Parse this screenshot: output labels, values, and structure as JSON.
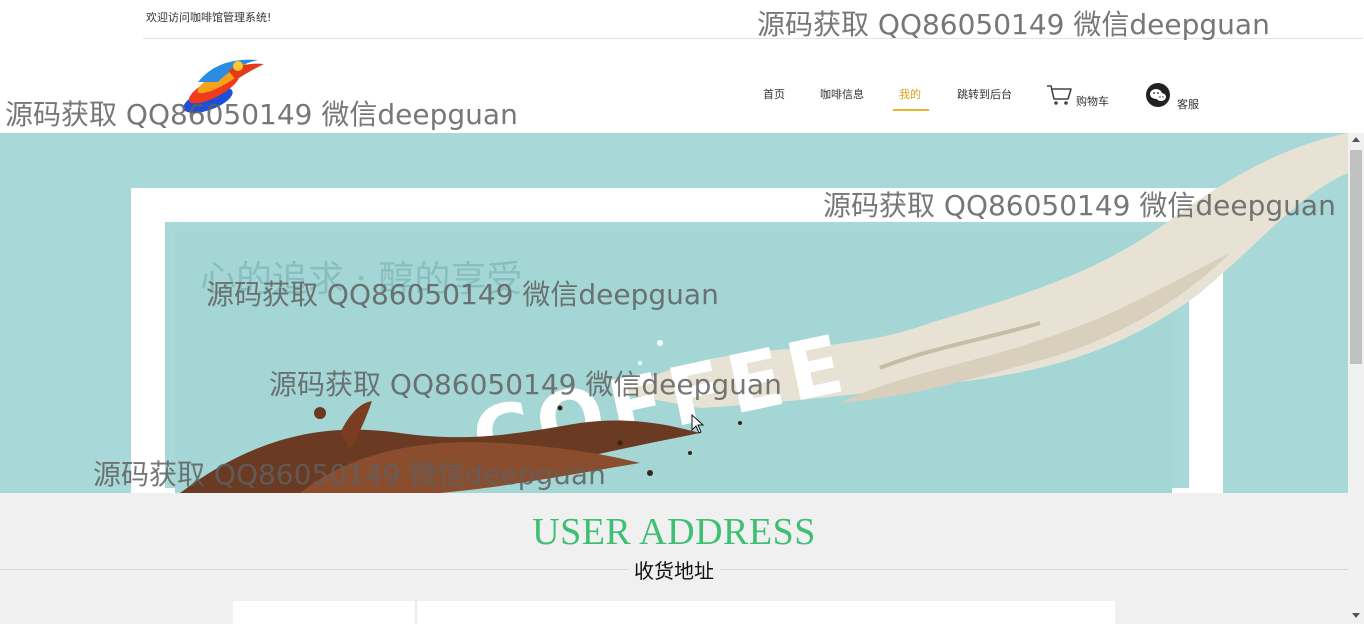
{
  "header": {
    "welcome": "欢迎访问咖啡馆管理系统!"
  },
  "nav": {
    "items": [
      {
        "label": "首页",
        "name": "nav-home"
      },
      {
        "label": "咖啡信息",
        "name": "nav-coffee-info"
      },
      {
        "label": "我的",
        "name": "nav-mine",
        "active": true
      },
      {
        "label": "跳转到后台",
        "name": "nav-admin"
      }
    ],
    "cart_label": "购物车",
    "service_label": "客服"
  },
  "banner": {
    "slogan": "心的追求 · 醇的享受",
    "coffee_text": "COFFEE"
  },
  "section": {
    "title": "USER ADDRESS",
    "subtitle": "收货地址"
  },
  "watermark": "源码获取 QQ86050149 微信deepguan",
  "colors": {
    "accent_active": "#d7a11d",
    "title_green": "#3ebf73",
    "banner_bg": "#a9d8d8"
  },
  "icons": {
    "cart": "cart-icon",
    "service": "wechat-icon",
    "logo": "logo-icon"
  }
}
